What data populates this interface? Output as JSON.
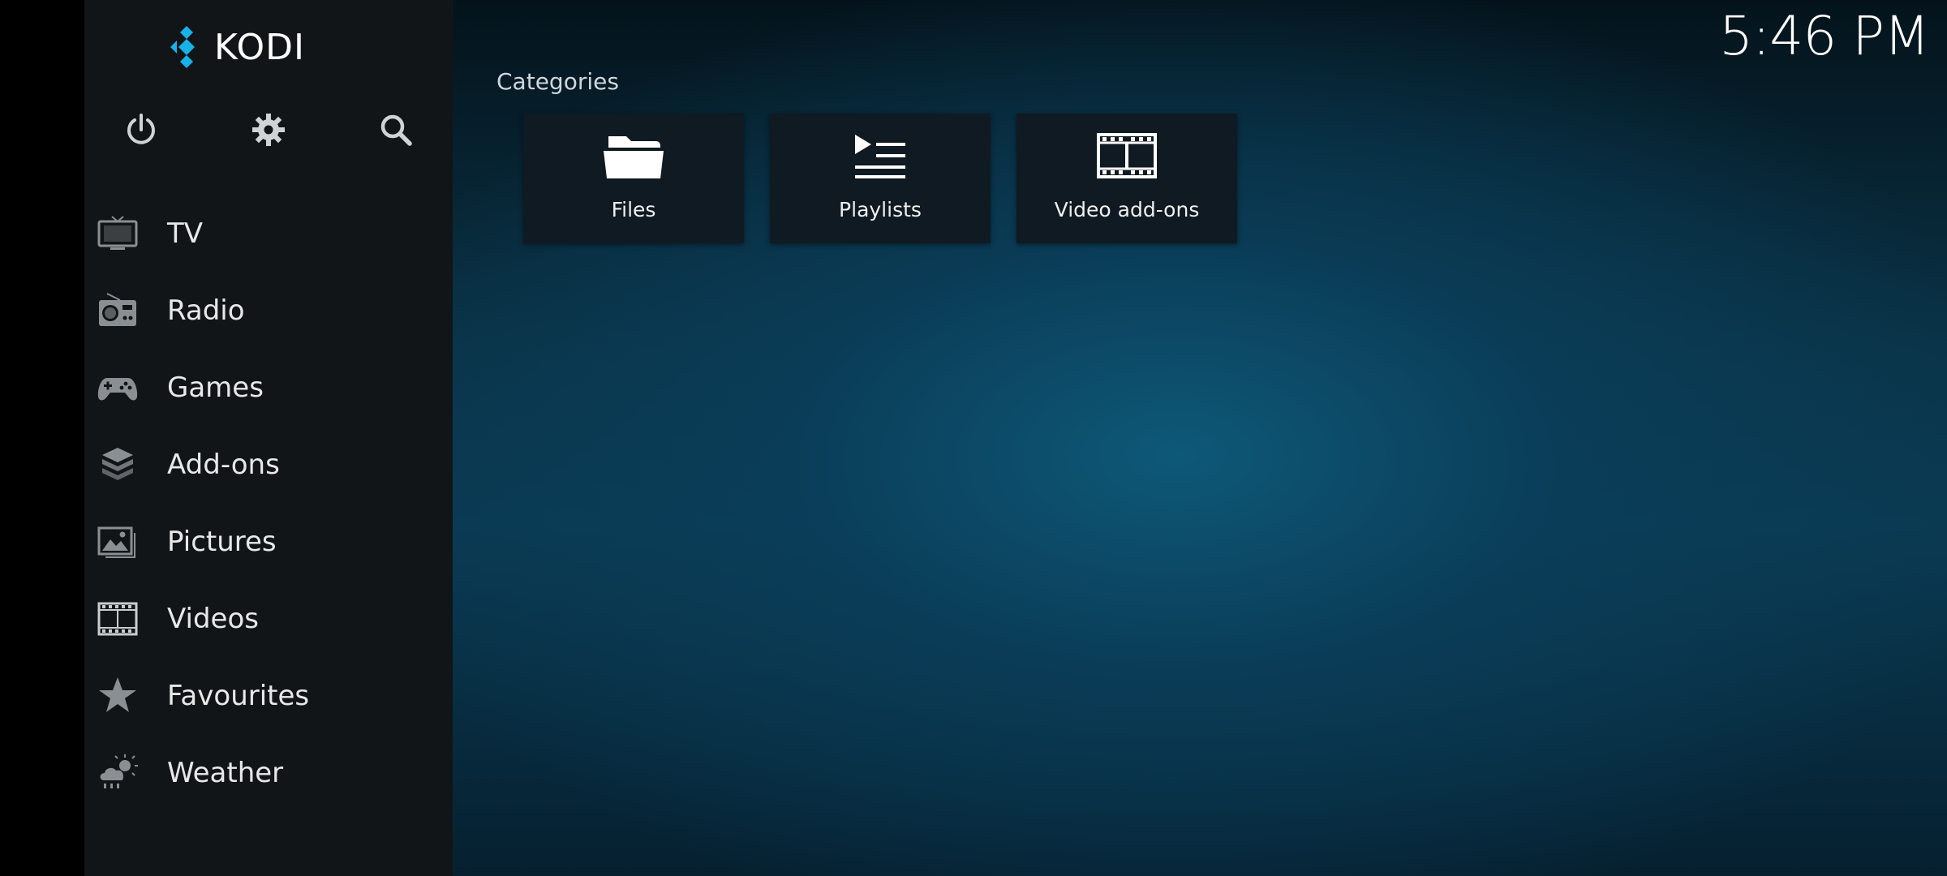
{
  "app": {
    "logo_text": "KODI",
    "clock": "5:46 PM"
  },
  "top_icons": [
    {
      "name": "power-icon"
    },
    {
      "name": "settings-icon"
    },
    {
      "name": "search-icon"
    }
  ],
  "sidebar": {
    "items": [
      {
        "label": "TV",
        "icon": "tv-icon"
      },
      {
        "label": "Radio",
        "icon": "radio-icon"
      },
      {
        "label": "Games",
        "icon": "gamepad-icon"
      },
      {
        "label": "Add-ons",
        "icon": "addons-box-icon"
      },
      {
        "label": "Pictures",
        "icon": "pictures-icon"
      },
      {
        "label": "Videos",
        "icon": "film-icon"
      },
      {
        "label": "Favourites",
        "icon": "star-icon"
      },
      {
        "label": "Weather",
        "icon": "weather-icon"
      }
    ]
  },
  "main": {
    "section_title": "Categories",
    "tiles": [
      {
        "label": "Files",
        "icon": "folder-icon"
      },
      {
        "label": "Playlists",
        "icon": "playlist-icon"
      },
      {
        "label": "Video add-ons",
        "icon": "film-strip-icon"
      }
    ]
  },
  "colors": {
    "logo_accent": "#17b2e8",
    "sidebar_bg": "#121518",
    "icon_gray": "#8a8f93",
    "top_icon_gray": "#cfd3d6"
  }
}
